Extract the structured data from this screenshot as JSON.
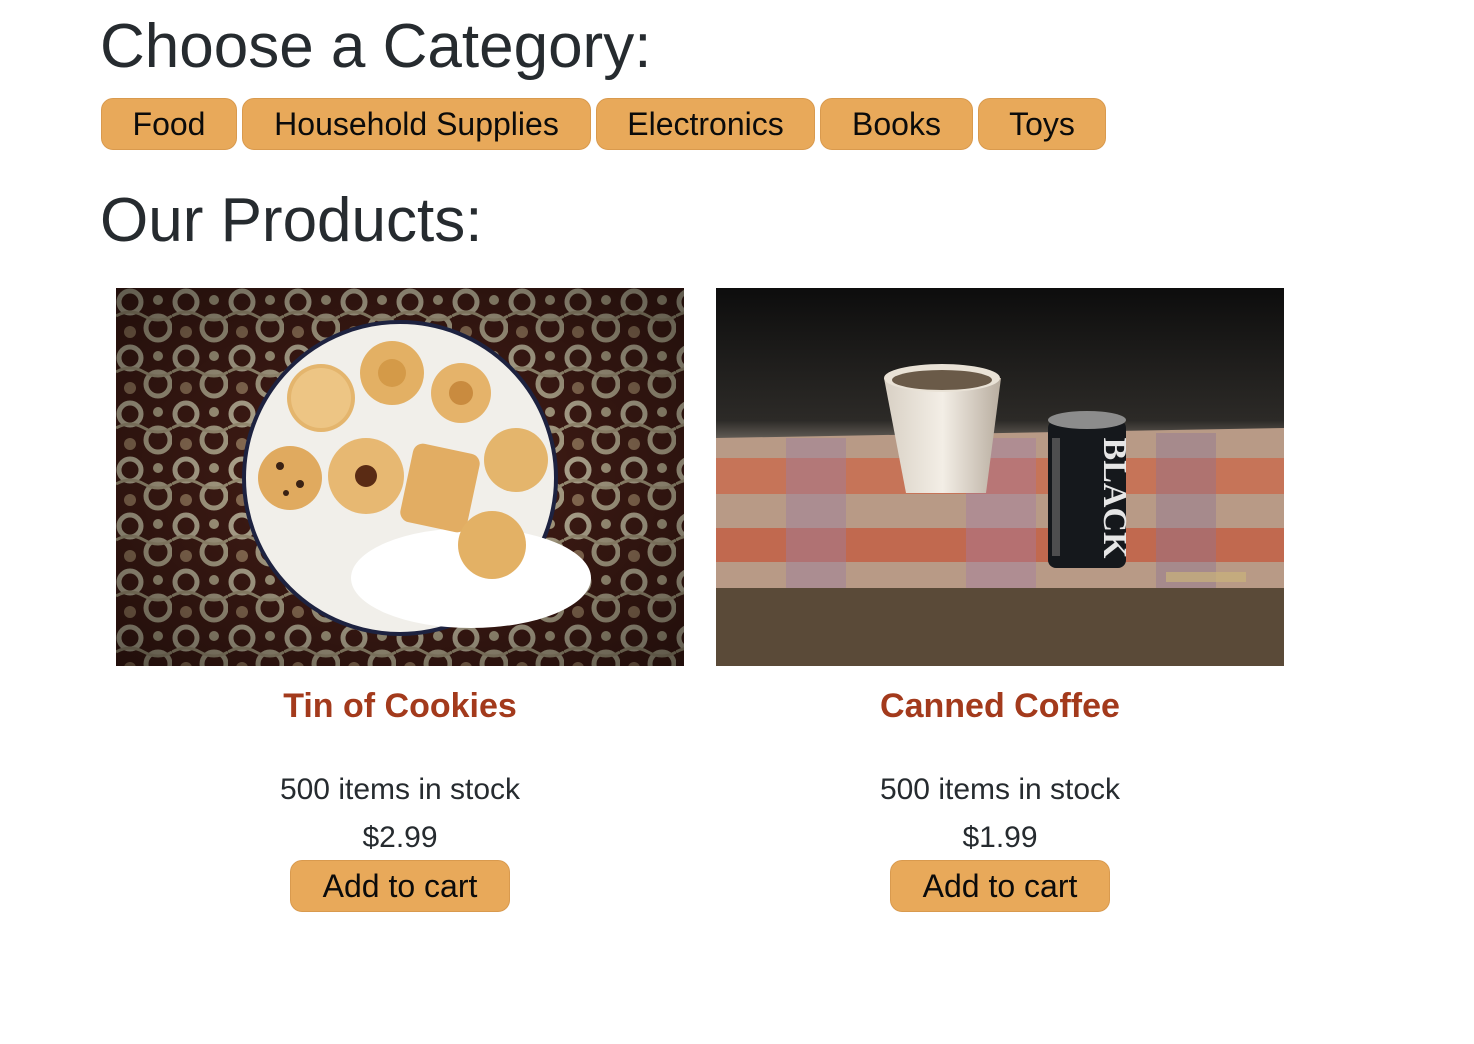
{
  "categories_section": {
    "heading": "Choose a Category:",
    "items": [
      {
        "label": "Food"
      },
      {
        "label": "Household Supplies"
      },
      {
        "label": "Electronics"
      },
      {
        "label": "Books"
      },
      {
        "label": "Toys"
      }
    ]
  },
  "products_section": {
    "heading": "Our Products:",
    "products": [
      {
        "name": "Tin of Cookies",
        "stock": "500 items in stock",
        "price": "$2.99",
        "button": "Add to cart",
        "image": "cookie-tin-photo"
      },
      {
        "name": "Canned Coffee",
        "stock": "500 items in stock",
        "price": "$1.99",
        "button": "Add to cart",
        "image": "canned-coffee-photo"
      }
    ]
  },
  "colors": {
    "button_bg": "#e8a95a",
    "product_title": "#a33a1c",
    "text": "#262b2f"
  }
}
